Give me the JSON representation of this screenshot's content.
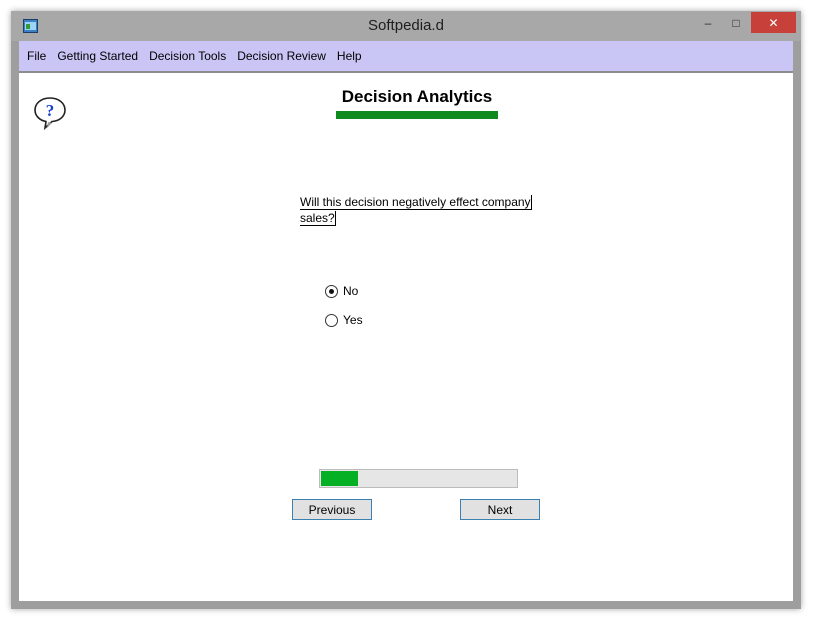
{
  "window": {
    "title": "Softpedia.d",
    "minimize_glyph": "–",
    "maximize_glyph": "□",
    "close_glyph": "✕"
  },
  "menu": {
    "items": [
      {
        "label": "File"
      },
      {
        "label": "Getting Started"
      },
      {
        "label": "Decision Tools"
      },
      {
        "label": "Decision Review"
      },
      {
        "label": "Help"
      }
    ]
  },
  "page": {
    "heading": "Decision Analytics",
    "help_icon": "question-bubble-icon",
    "question_line1": "Will this decision negatively effect company",
    "question_line2": "sales?"
  },
  "options": [
    {
      "label": "No",
      "selected": true
    },
    {
      "label": "Yes",
      "selected": false
    }
  ],
  "progress": {
    "fraction": 0.2
  },
  "buttons": {
    "previous": "Previous",
    "next": "Next"
  },
  "colors": {
    "menubar": "#c9c6f6",
    "heading_bar": "#0f8a1f",
    "progress_fill": "#06b025",
    "close_button": "#c7403a"
  }
}
